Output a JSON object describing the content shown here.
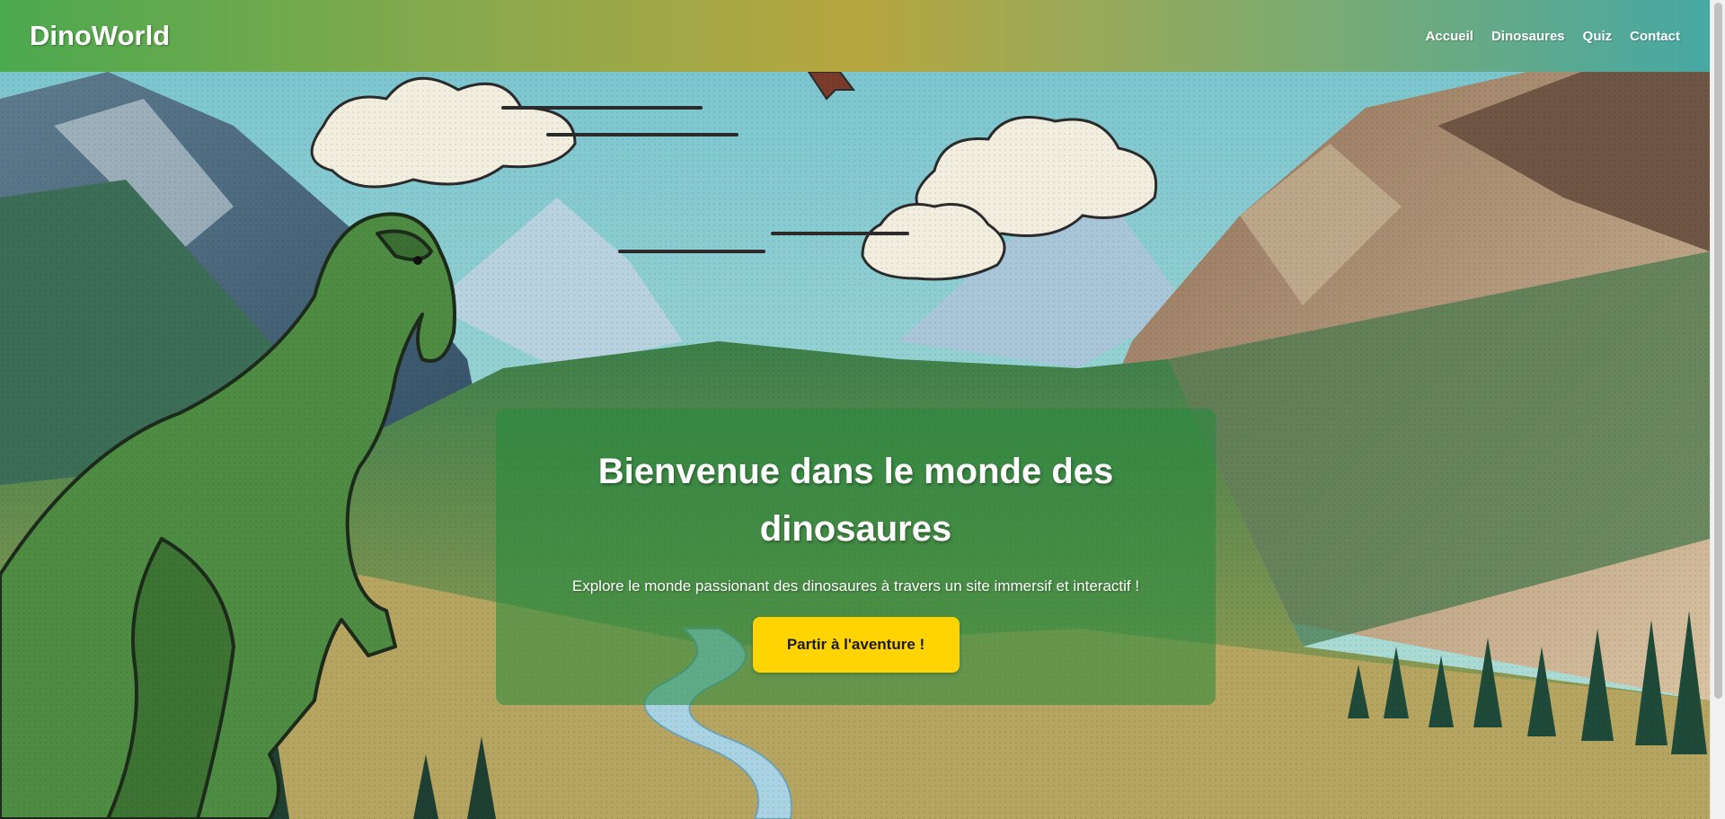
{
  "header": {
    "logo": "DinoWorld",
    "nav": [
      "Accueil",
      "Dinosaures",
      "Quiz",
      "Contact"
    ]
  },
  "hero": {
    "title": "Bienvenue dans le monde des dinosaures",
    "subtitle": "Explore le monde passionant des dinosaures à travers un site immersif et interactif !",
    "cta_label": "Partir à l'aventure !",
    "image_icon": "dinosaur-valley-illustration"
  },
  "colors": {
    "header_start": "#4ca94f",
    "header_mid": "#b7a63f",
    "header_end": "#47a8a4",
    "cta_bg": "#ffd400",
    "card_bg": "rgba(34,139,60,0.55)"
  }
}
